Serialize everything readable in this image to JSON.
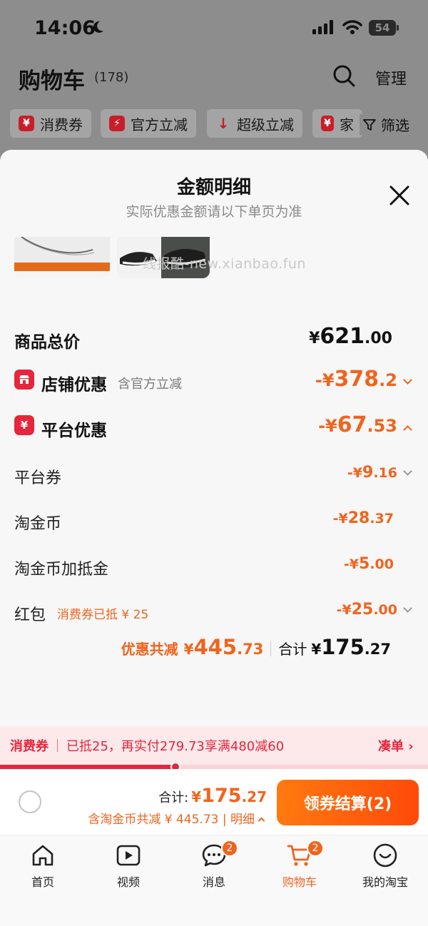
{
  "status": {
    "time": "14:06",
    "battery": "54"
  },
  "header": {
    "title": "购物车",
    "count": "(178)",
    "manage": "管理"
  },
  "chips": [
    {
      "icon": "¥",
      "label": "消费券"
    },
    {
      "icon": "⚡",
      "label": "官方立减"
    },
    {
      "icon": "↓",
      "label": "超级立减"
    },
    {
      "icon": "¥",
      "label": "家"
    }
  ],
  "filter_label": "筛选",
  "sheet": {
    "title": "金额明细",
    "subtitle": "实际优惠金额请以下单页为准",
    "watermark": "线报酷-new.xianbao.fun"
  },
  "breakdown": {
    "total": {
      "label": "商品总价",
      "symbol": "¥",
      "int": "621",
      "dec": ".00"
    },
    "shop": {
      "label": "店铺优惠",
      "note": "含官方立减",
      "prefix": "-¥",
      "int": "378",
      "dec": ".2"
    },
    "platform": {
      "label": "平台优惠",
      "prefix": "-¥",
      "int": "67",
      "dec": ".53"
    },
    "items": [
      {
        "label": "平台券",
        "prefix": "-¥",
        "int": "9",
        "dec": ".16"
      },
      {
        "label": "淘金币",
        "prefix": "-¥",
        "int": "28",
        "dec": ".37"
      },
      {
        "label": "淘金币加抵金",
        "prefix": "-¥",
        "int": "5",
        "dec": ".00"
      },
      {
        "label": "红包",
        "note": "消费券已抵 ¥ 25",
        "prefix": "-¥",
        "int": "25",
        "dec": ".00"
      }
    ],
    "summary": {
      "discount_label": "优惠共减",
      "discount_symbol": "¥",
      "discount_int": "445",
      "discount_dec": ".73",
      "total_label": "合计",
      "total_symbol": "¥",
      "total_int": "175",
      "total_dec": ".27"
    }
  },
  "coupon_strip": {
    "tag": "消费券",
    "text": "已抵25，再实付279.73享满480减60",
    "action": "凑单",
    "progress": 0.41
  },
  "checkout": {
    "total_label": "合计:",
    "symbol": "¥",
    "int": "175",
    "dec": ".27",
    "sub": "含淘金币共减 ¥ 445.73 | 明细",
    "button": "领券结算(2)"
  },
  "tabs": [
    {
      "label": "首页"
    },
    {
      "label": "视频"
    },
    {
      "label": "消息",
      "badge": "2"
    },
    {
      "label": "购物车",
      "badge": "2"
    },
    {
      "label": "我的淘宝"
    }
  ],
  "colors": {
    "accent": "#f0641e",
    "red": "#e5263c"
  }
}
